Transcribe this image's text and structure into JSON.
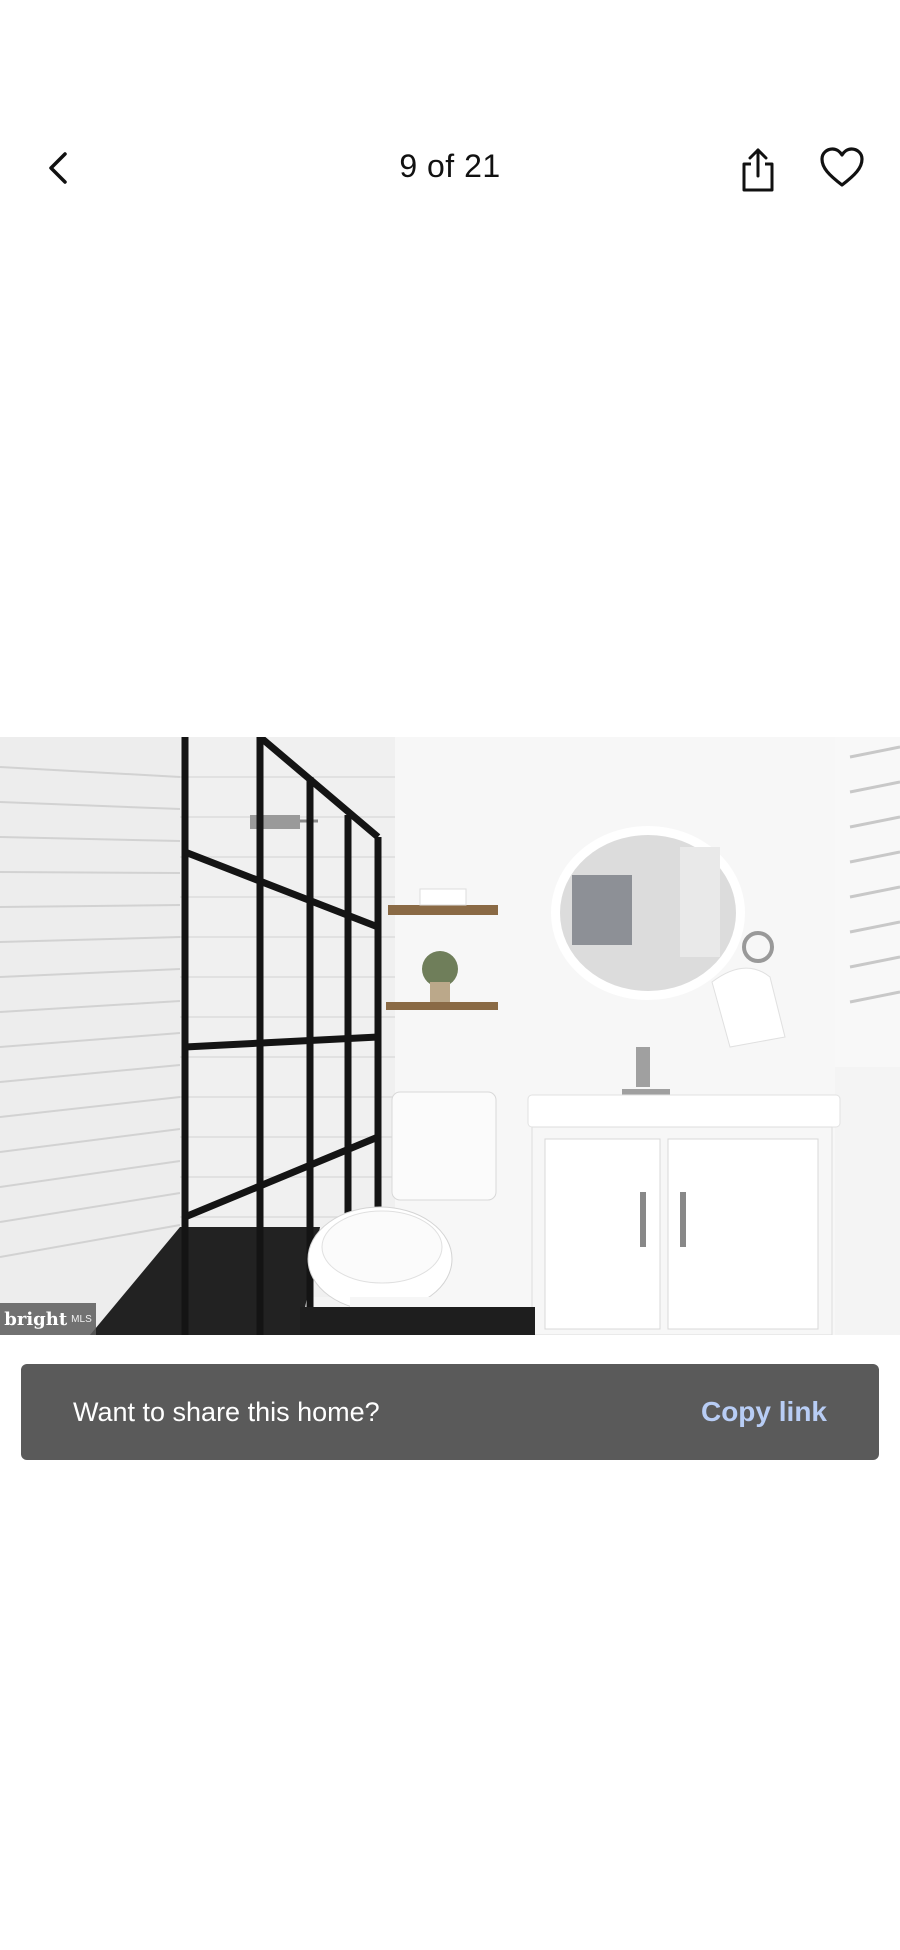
{
  "header": {
    "photo_counter": "9 of 21",
    "icons": {
      "back": "chevron-left-icon",
      "share": "share-icon",
      "favorite": "heart-icon"
    }
  },
  "photo": {
    "watermark_brand": "bright",
    "watermark_suffix": "MLS"
  },
  "toast": {
    "message": "Want to share this home?",
    "action_label": "Copy link",
    "action_color": "#b8cdf5",
    "background_color": "#5a5a5a"
  }
}
